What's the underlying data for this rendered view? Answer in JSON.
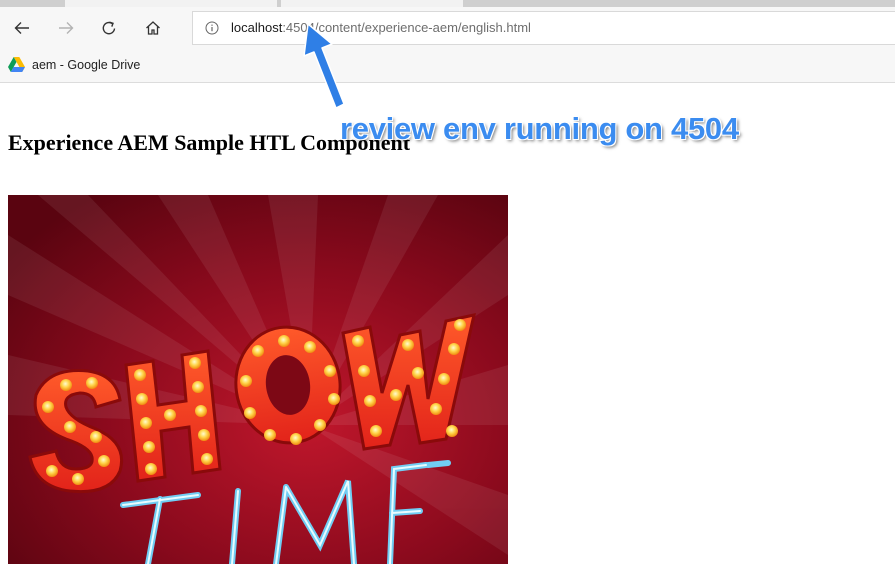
{
  "browser": {
    "url_host": "localhost",
    "url_path": ":4504/content/experience-aem/english.html",
    "bookmark_label": "aem - Google Drive"
  },
  "page": {
    "heading": "Experience AEM Sample HTL Component",
    "image_alt": "SHOW TIME"
  },
  "annotation": {
    "text": "review env running on 4504",
    "color": "#3b8cf0"
  }
}
